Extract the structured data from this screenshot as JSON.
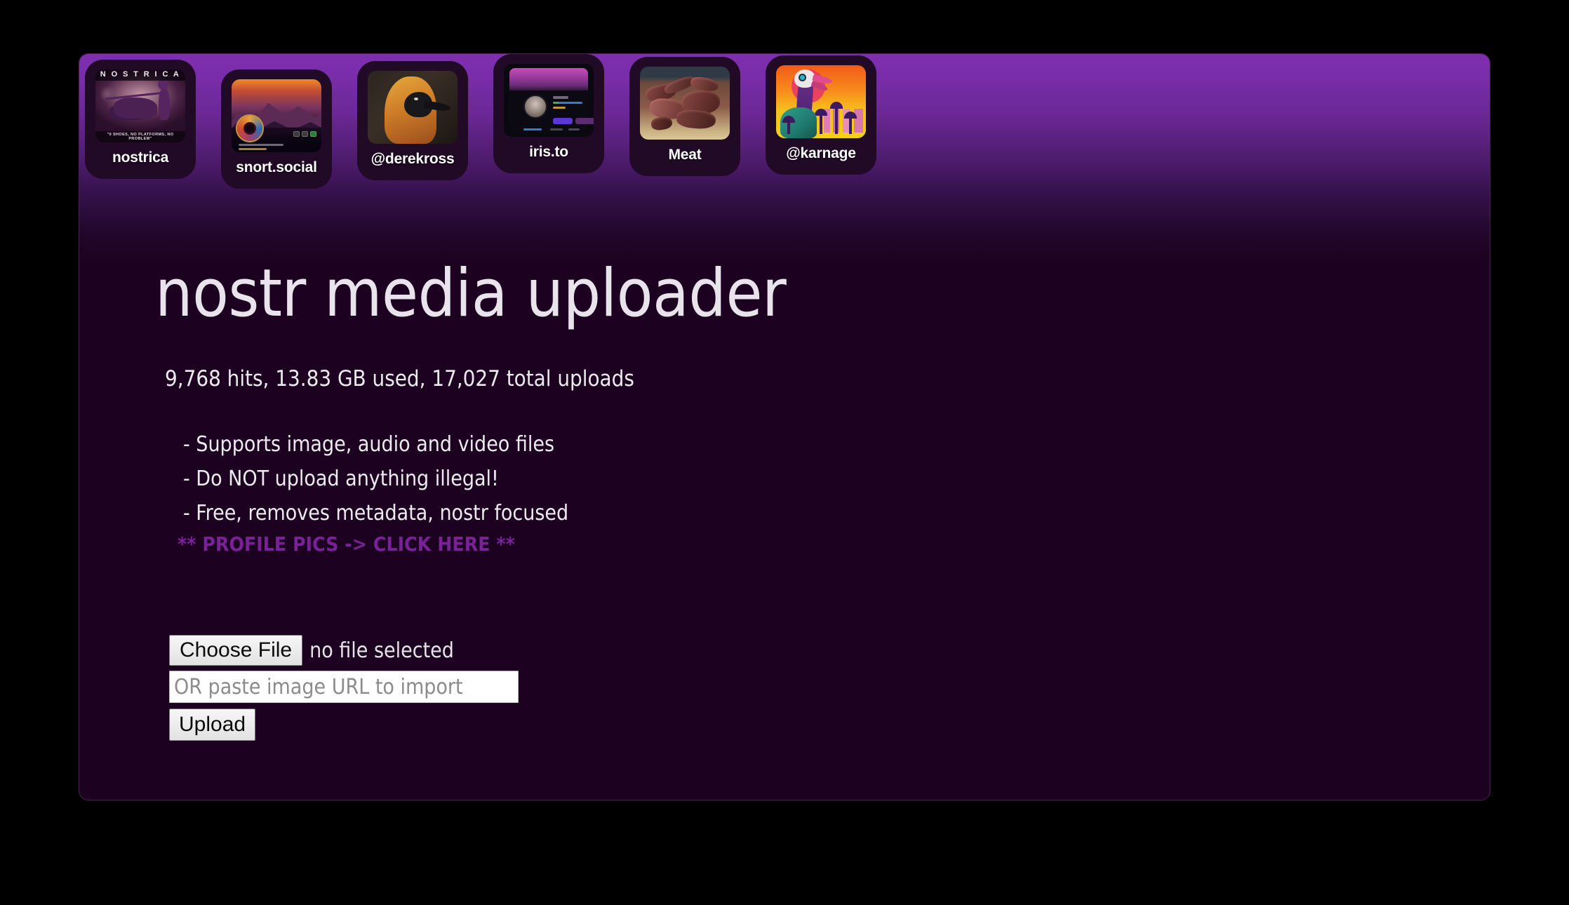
{
  "bookmarks": {
    "items": [
      {
        "label": "nostrica",
        "icon": "nostrica-thumbnail"
      },
      {
        "label": "snort.social",
        "icon": "snort-social-thumbnail"
      },
      {
        "label": "@derekross",
        "icon": "derekross-avatar-thumbnail"
      },
      {
        "label": "iris.to",
        "icon": "iris-to-thumbnail"
      },
      {
        "label": "Meat",
        "icon": "meat-photo-thumbnail"
      },
      {
        "label": "@karnage",
        "icon": "karnage-avatar-thumbnail"
      }
    ],
    "nostrica_art": {
      "title": "N O S T R I C A",
      "tagline": "\"0 SHOES, NO PLATFORMS, NO PROBLEM\""
    }
  },
  "main": {
    "headline": "nostr media uploader",
    "stats": "9,768 hits, 13.83 GB used,  17,027 total uploads",
    "bullets": [
      "- Supports image, audio and video files",
      "- Do NOT upload anything illegal!",
      "- Free, removes metadata, nostr focused"
    ],
    "profile_link": "** PROFILE PICS -> CLICK HERE **"
  },
  "form": {
    "choose_file_label": "Choose File",
    "file_status": "no file selected",
    "url_placeholder": "OR paste image URL to import",
    "url_value": "",
    "upload_label": "Upload"
  },
  "colors": {
    "header_gradient_top": "#7d2fae",
    "page_background": "#1c0220",
    "page_border": "#4a2150",
    "link_purple": "#7a2199",
    "text_primary": "#eceaee",
    "outer_background": "#000000"
  }
}
